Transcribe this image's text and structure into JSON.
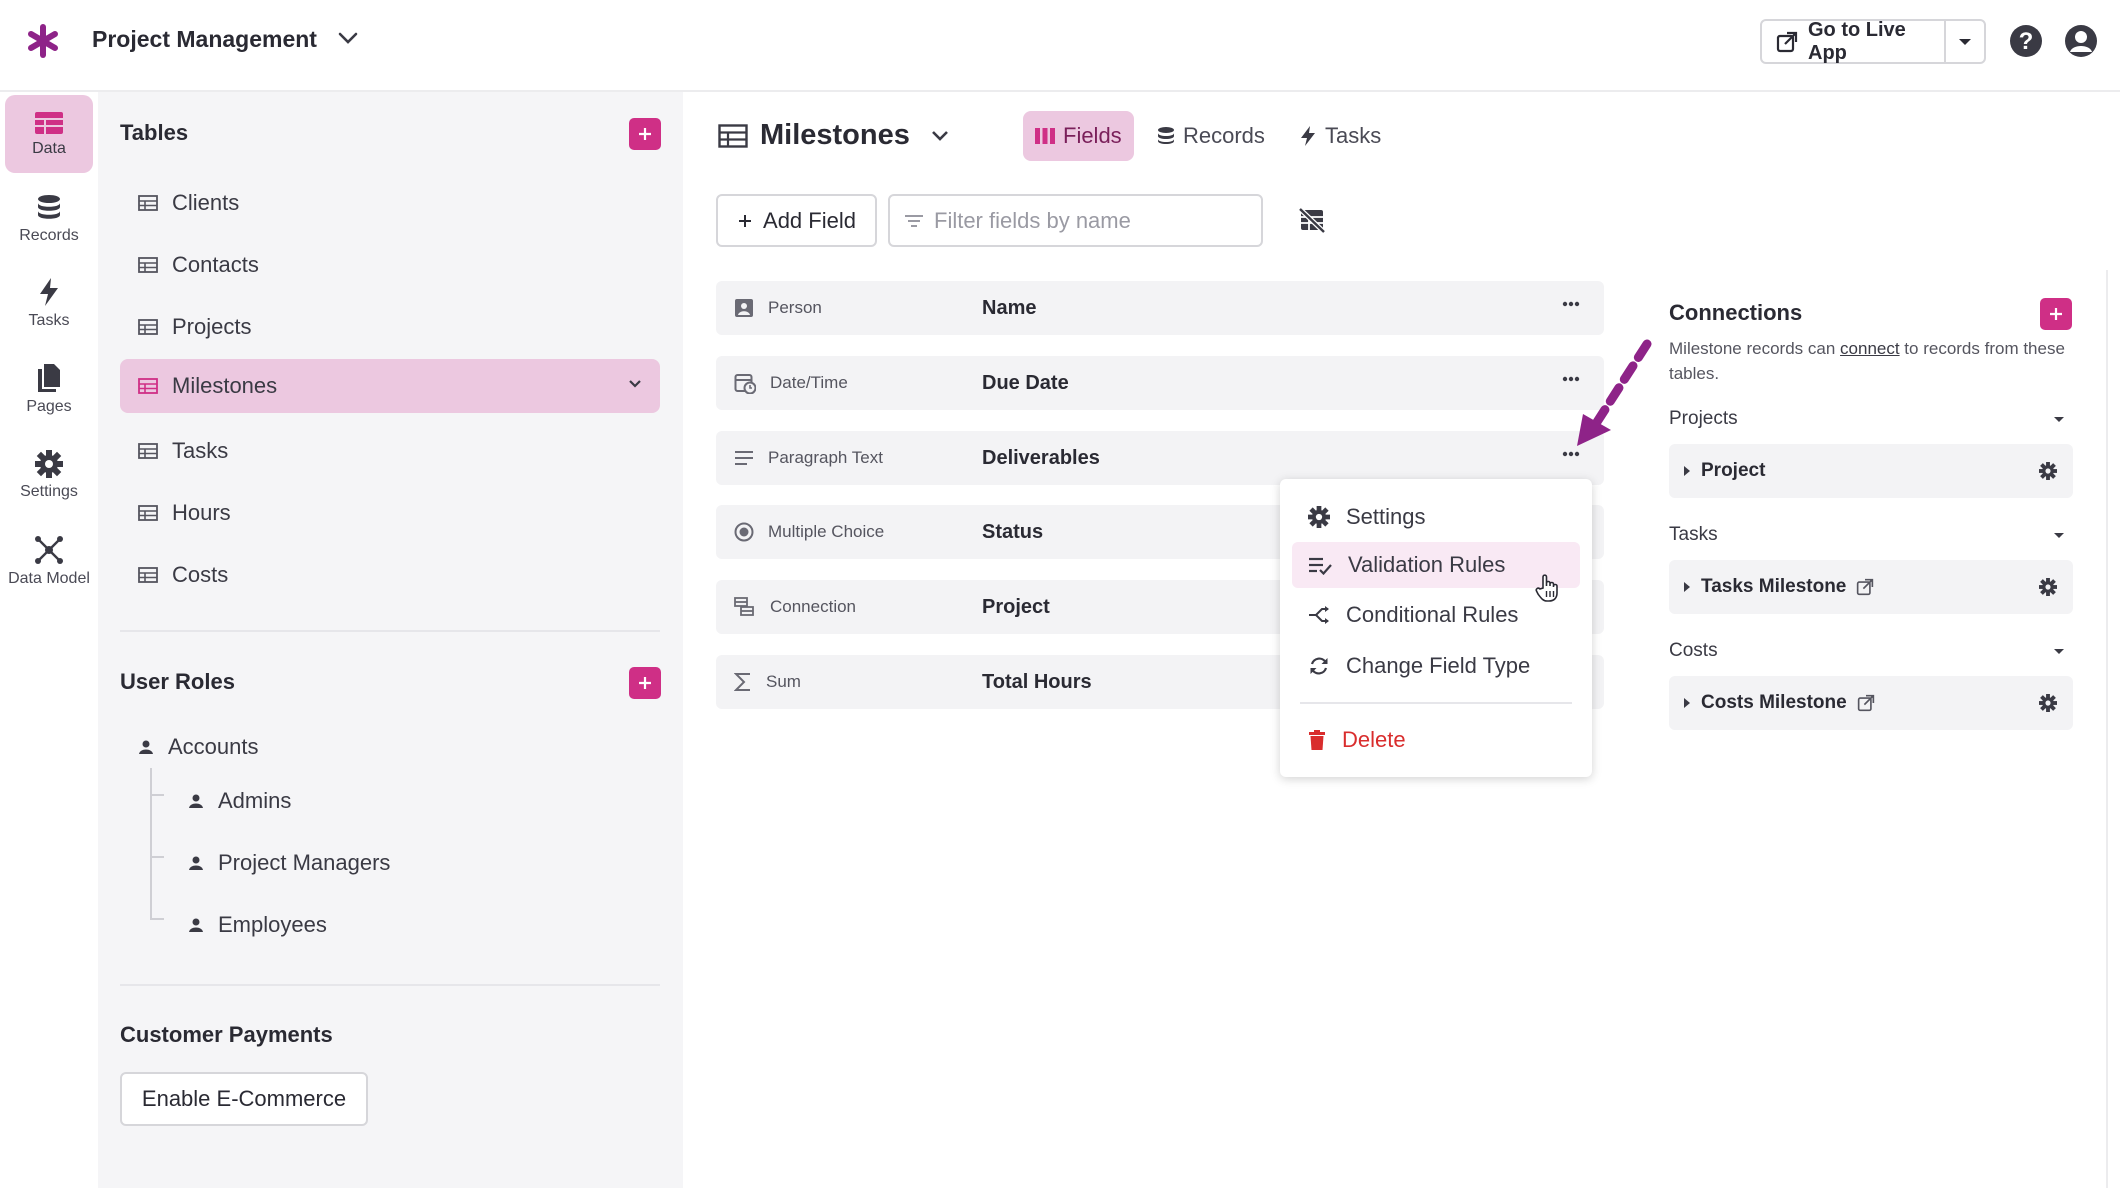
{
  "app": {
    "title": "Project Management",
    "live_button": "Go to Live App"
  },
  "rail": [
    {
      "label": "Data",
      "icon": "table-icon",
      "active": true
    },
    {
      "label": "Records",
      "icon": "database-icon"
    },
    {
      "label": "Tasks",
      "icon": "bolt-icon"
    },
    {
      "label": "Pages",
      "icon": "pages-icon"
    },
    {
      "label": "Settings",
      "icon": "gear-icon"
    },
    {
      "label": "Data Model",
      "icon": "data-model-icon"
    }
  ],
  "tables_panel": {
    "title": "Tables",
    "items": [
      "Clients",
      "Contacts",
      "Projects",
      "Milestones",
      "Tasks",
      "Hours",
      "Costs"
    ],
    "active_index": 3
  },
  "user_roles": {
    "title": "User Roles",
    "root": "Accounts",
    "children": [
      "Admins",
      "Project Managers",
      "Employees"
    ]
  },
  "payments": {
    "title": "Customer Payments",
    "button": "Enable E-Commerce"
  },
  "main": {
    "title": "Milestones",
    "tabs": [
      "Fields",
      "Records",
      "Tasks"
    ],
    "active_tab": 0,
    "add_field": "Add Field",
    "filter_placeholder": "Filter fields by name"
  },
  "fields": [
    {
      "type": "Person",
      "name": "Name",
      "icon": "person-icon"
    },
    {
      "type": "Date/Time",
      "name": "Due Date",
      "icon": "calendar-clock-icon"
    },
    {
      "type": "Paragraph Text",
      "name": "Deliverables",
      "icon": "paragraph-icon"
    },
    {
      "type": "Multiple Choice",
      "name": "Status",
      "icon": "radio-icon"
    },
    {
      "type": "Connection",
      "name": "Project",
      "icon": "connection-icon"
    },
    {
      "type": "Sum",
      "name": "Total Hours",
      "icon": "sigma-icon"
    }
  ],
  "context_menu": {
    "items": [
      "Settings",
      "Validation Rules",
      "Conditional Rules",
      "Change Field Type"
    ],
    "hover_index": 1,
    "delete": "Delete"
  },
  "connections": {
    "title": "Connections",
    "desc_before": "Milestone records can ",
    "desc_link": "connect",
    "desc_after": " to records from these tables.",
    "groups": [
      {
        "name": "Projects",
        "item": "Project",
        "external": false
      },
      {
        "name": "Tasks",
        "item": "Tasks Milestone",
        "external": true
      },
      {
        "name": "Costs",
        "item": "Costs Milestone",
        "external": true
      }
    ]
  },
  "colors": {
    "accent": "#cf2f86",
    "active_bg": "#ecc8e0",
    "panel_bg": "#f5f5f7",
    "danger": "#d92d2d",
    "arrow": "#8e2388"
  }
}
